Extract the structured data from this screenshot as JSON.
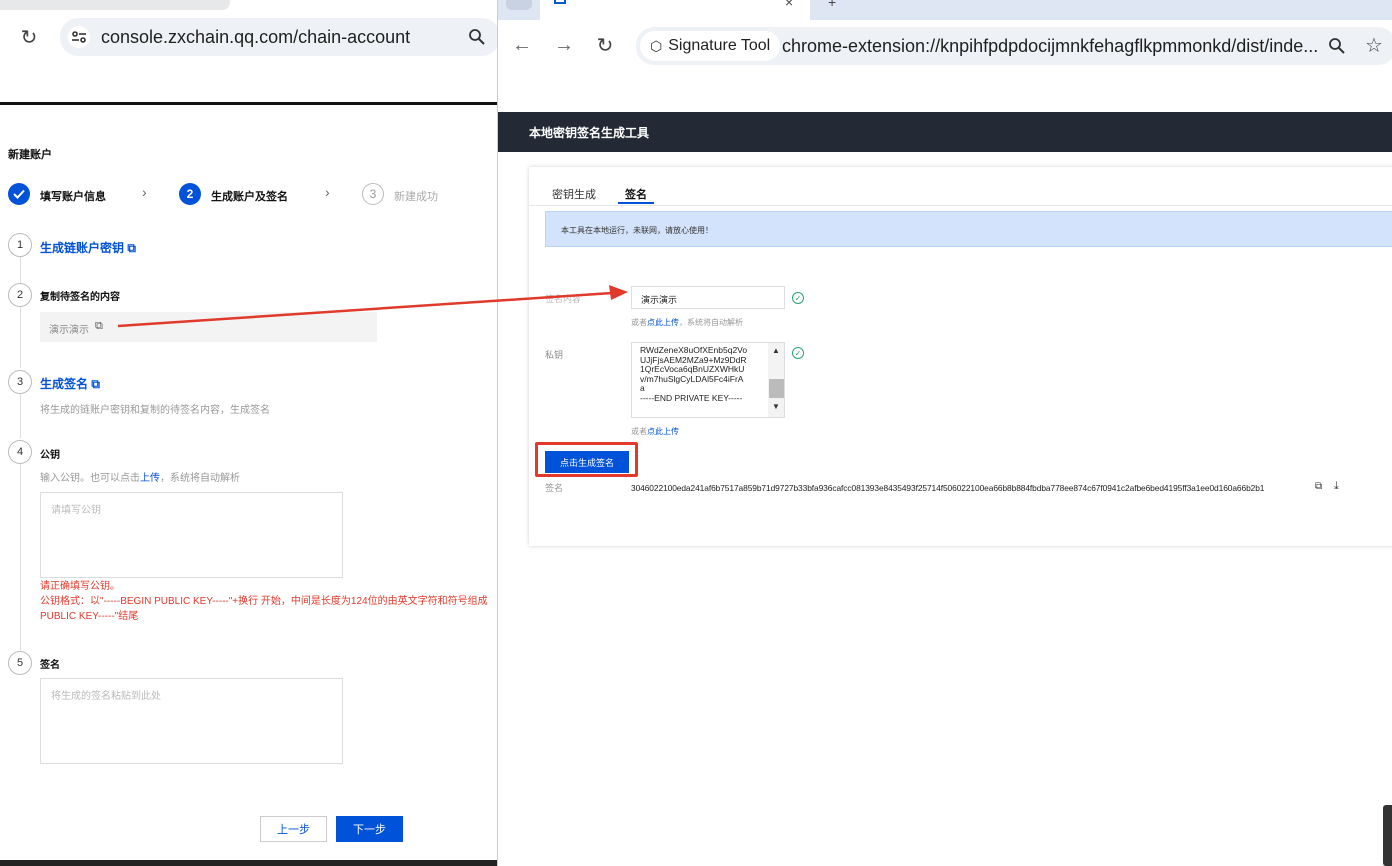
{
  "left_window": {
    "url": "console.zxchain.qq.com/chain-account",
    "page_title": "新建账户",
    "steps": [
      {
        "num": "1",
        "label": "填写账户信息",
        "state": "done"
      },
      {
        "num": "2",
        "label": "生成账户及签名",
        "state": "active"
      },
      {
        "num": "3",
        "label": "新建成功",
        "state": "wait"
      }
    ],
    "items": {
      "i1": {
        "num": "1",
        "title": "生成链账户密钥"
      },
      "i2": {
        "num": "2",
        "title": "复制待签名的内容",
        "value": "演示演示"
      },
      "i3": {
        "num": "3",
        "title": "生成签名",
        "desc": "将生成的链账户密钥和复制的待签名内容，生成签名"
      },
      "i4": {
        "num": "4",
        "title": "公钥",
        "desc_prefix": "输入公钥。也可以点击",
        "desc_link": "上传",
        "desc_suffix": "，系统将自动解析",
        "placeholder": "请填写公钥",
        "error_line1": "请正确填写公钥。",
        "error_line2": "公钥格式：以\"-----BEGIN PUBLIC KEY-----\"+换行 开始，中间是长度为124位的由英文字符和符号组成",
        "error_line3": "PUBLIC KEY-----\"结尾"
      },
      "i5": {
        "num": "5",
        "title": "签名",
        "placeholder": "将生成的签名粘贴到此处"
      }
    },
    "buttons": {
      "prev": "上一步",
      "next": "下一步"
    }
  },
  "right_window": {
    "ext_chip": "Signature Tool",
    "url": "chrome-extension://knpihfpdpdocijmnkfehagflkpmmonkd/dist/inde...",
    "header_title": "本地密钥签名生成工具",
    "tabs": [
      "密钥生成",
      "签名"
    ],
    "notice": "本工具在本地运行，未联网，请放心使用！",
    "content_label": "签名内容",
    "content_value": "演示演示",
    "upload_hint_prefix": "或者",
    "upload_hint_link": "点此上传",
    "upload_hint_suffix": "，系统将自动解析",
    "private_key_label": "私钥",
    "private_key_lines": [
      "RWdZeneX8uOfXEnb5q2Vo",
      "UJjFjsAEM2MZa9+Mz9DdR",
      "1QrEcVoca6qBnUZXWHkU",
      "v/m7huSlgCyLDAl5Fc4iFrA",
      "a",
      "-----END PRIVATE KEY-----"
    ],
    "upload_hint2_prefix": "或者",
    "upload_hint2_link": "点此上传",
    "generate_button": "点击生成签名",
    "signature_label": "签名",
    "signature_value": "3046022100eda241af6b7517a859b71d9727b33bfa936cafcc081393e8435493f25714f506022100ea66b8b884fbdba778ee874c67f0941c2afbe6bed4195ff3a1ee0d160a66b2b1"
  },
  "colors": {
    "accent": "#0052d9",
    "error": "#e1392b",
    "success": "#2ba471",
    "header_bg": "#232a36",
    "notice_bg": "#d4e3fc"
  }
}
